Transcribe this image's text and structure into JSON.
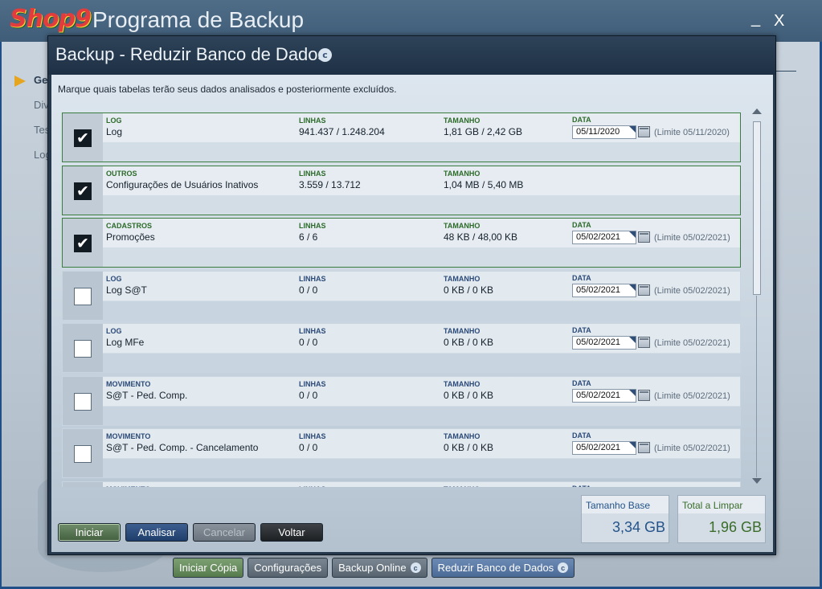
{
  "app": {
    "logo": "Shop9",
    "title": "Programa de Backup",
    "minimize": "_",
    "close": "X",
    "menu": [
      "Ge",
      "Div",
      "Tes",
      "Log"
    ]
  },
  "bottom_bar": {
    "buttons": [
      {
        "label": "Iniciar Cópia"
      },
      {
        "label": "Configurações"
      },
      {
        "label": "Backup Online",
        "badge": "c"
      },
      {
        "label": "Reduzir Banco de Dados",
        "badge": "c"
      }
    ]
  },
  "dialog": {
    "title": "Backup - Reduzir Banco de Dados",
    "title_badge": "c",
    "instruction": "Marque quais tabelas terão seus dados analisados e posteriormente excluídos.",
    "col_labels": {
      "linhas": "LINHAS",
      "tamanho": "TAMANHO",
      "data": "DATA"
    },
    "rows": [
      {
        "checked": true,
        "category": "LOG",
        "name": "Log",
        "linhas": "941.437 / 1.248.204",
        "tamanho": "1,81 GB / 2,42 GB",
        "data": "05/11/2020",
        "limite": "(Limite 05/11/2020)"
      },
      {
        "checked": true,
        "category": "OUTROS",
        "name": "Configurações de Usuários Inativos",
        "linhas": "3.559 / 13.712",
        "tamanho": "1,04 MB / 5,40 MB",
        "data": "",
        "limite": ""
      },
      {
        "checked": true,
        "category": "CADASTROS",
        "name": "Promoções",
        "linhas": "6 / 6",
        "tamanho": "48 KB / 48,00 KB",
        "data": "05/02/2021",
        "limite": "(Limite 05/02/2021)"
      },
      {
        "checked": false,
        "category": "LOG",
        "name": "Log S@T",
        "linhas": "0 / 0",
        "tamanho": "0 KB / 0 KB",
        "data": "05/02/2021",
        "limite": "(Limite 05/02/2021)"
      },
      {
        "checked": false,
        "category": "LOG",
        "name": "Log MFe",
        "linhas": "0 / 0",
        "tamanho": "0 KB / 0 KB",
        "data": "05/02/2021",
        "limite": "(Limite 05/02/2021)"
      },
      {
        "checked": false,
        "category": "MOVIMENTO",
        "name": "S@T - Ped. Comp.",
        "linhas": "0 / 0",
        "tamanho": "0 KB / 0 KB",
        "data": "05/02/2021",
        "limite": "(Limite 05/02/2021)"
      },
      {
        "checked": false,
        "category": "MOVIMENTO",
        "name": "S@T - Ped. Comp. - Cancelamento",
        "linhas": "0 / 0",
        "tamanho": "0 KB / 0 KB",
        "data": "05/02/2021",
        "limite": "(Limite 05/02/2021)"
      },
      {
        "checked": false,
        "category": "MOVIMENTO",
        "name": "",
        "linhas": "",
        "tamanho": "",
        "data": "",
        "limite": ""
      }
    ],
    "buttons": {
      "start": "Iniciar",
      "analyze": "Analisar",
      "cancel": "Cancelar",
      "back": "Voltar"
    },
    "stats": {
      "base_label": "Tamanho Base",
      "base_value": "3,34 GB",
      "total_label": "Total a Limpar",
      "total_value": "1,96 GB"
    },
    "checkmark": "✔"
  },
  "colors": {
    "checked_border": "#3a7d3e",
    "base_accent": "#24538a",
    "total_accent": "#3a6c2a"
  }
}
